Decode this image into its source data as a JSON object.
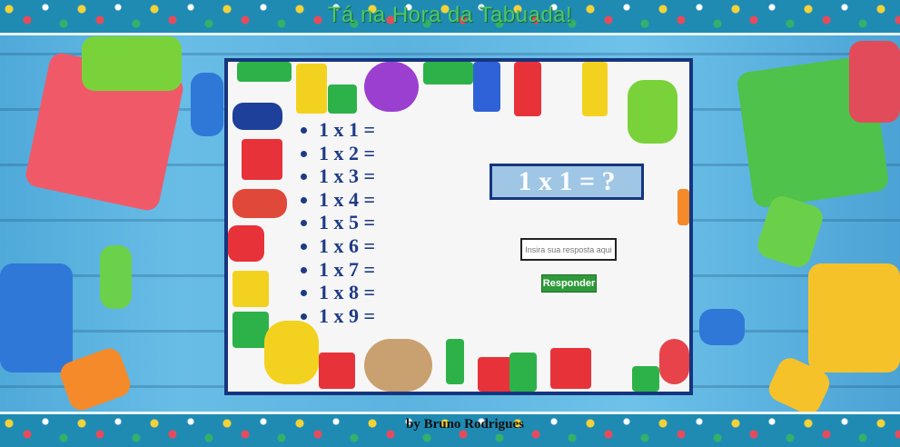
{
  "header": {
    "title": "Tá na Hora da Tabuada!"
  },
  "tabuada": {
    "items": [
      "1 x 1 =",
      "1 x 2 =",
      "1 x 3 =",
      "1 x 4 =",
      "1 x 5 =",
      "1 x 6 =",
      "1 x 7 =",
      "1 x 8 =",
      "1 x 9 ="
    ]
  },
  "question": {
    "text": "1 x 1 = ?"
  },
  "answer": {
    "placeholder": "Insira sua resposta aqui",
    "value": ""
  },
  "submit": {
    "label": "Responder"
  },
  "footer": {
    "credit": "by Bruno Rodrigues"
  },
  "colors": {
    "title": "#4cc86a",
    "card_border": "#16357f",
    "question_bg": "#9fc6e4",
    "button_bg": "#2f9a3a",
    "background": "#5cb3df"
  }
}
